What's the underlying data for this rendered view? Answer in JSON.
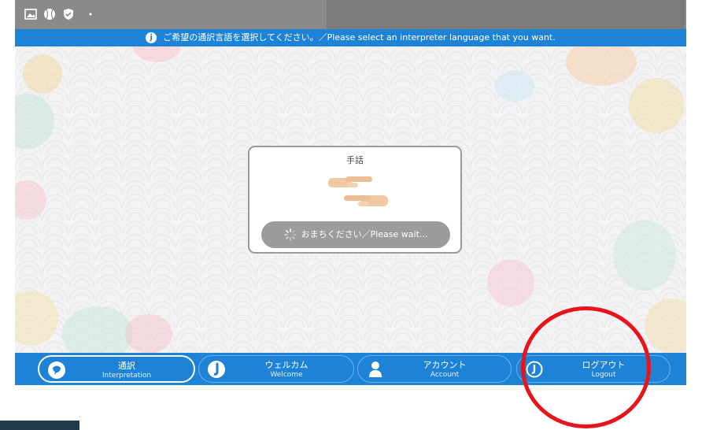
{
  "status_bar": {
    "icons": [
      "gallery-icon",
      "baseball-icon",
      "shield-check-icon",
      "dot-icon"
    ]
  },
  "banner": {
    "icon": "j",
    "text": "ご希望の通訳言語を選択してください。／Please select an interpreter language that you want."
  },
  "modal": {
    "title": "手話",
    "wait_label": "おまちください／Please wait..."
  },
  "nav": {
    "items": [
      {
        "jp": "通訳",
        "en": "Interpretation",
        "icon": "interpretation-icon",
        "active": true
      },
      {
        "jp": "ウェルカム",
        "en": "Welcome",
        "icon": "welcome-icon",
        "active": false
      },
      {
        "jp": "アカウント",
        "en": "Account",
        "icon": "account-icon",
        "active": false
      },
      {
        "jp": "ログアウト",
        "en": "Logout",
        "icon": "logout-icon",
        "active": false
      }
    ]
  },
  "colors": {
    "accent": "#1e83d6",
    "annotation": "#e8141b",
    "wait_button": "#9c9c9c"
  }
}
